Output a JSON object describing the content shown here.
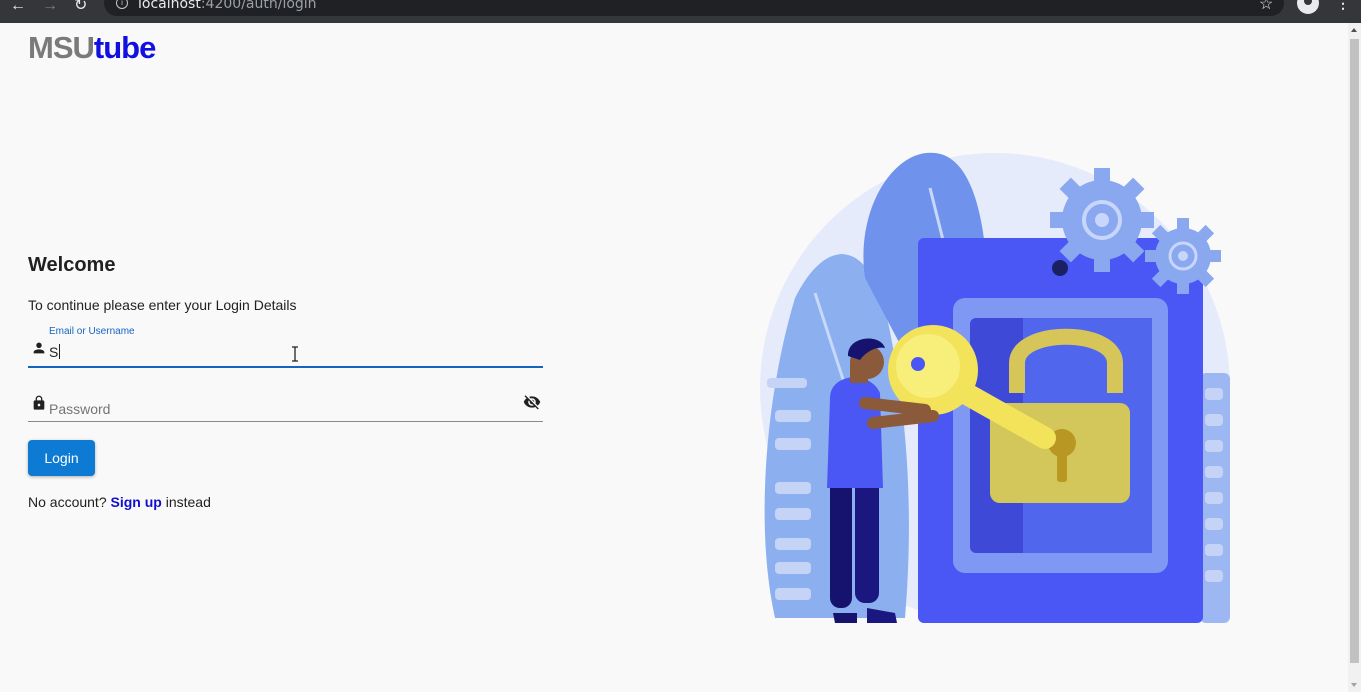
{
  "browser": {
    "url_host": "localhost",
    "url_rest": ":4200/auth/login"
  },
  "logo": {
    "part1": "MSU",
    "part2": "tube"
  },
  "login": {
    "title": "Welcome",
    "subtitle": "To continue please enter your Login Details",
    "email_label": "Email or Username",
    "email_value": "S",
    "password_placeholder": "Password",
    "button_label": "Login",
    "signup_prefix": "No account?",
    "signup_link": "Sign up",
    "signup_suffix": "instead"
  },
  "colors": {
    "accent": "#0d7bd4",
    "logo_gray": "#7a7a7a",
    "logo_blue": "#1010e0",
    "illustration_blue": "#4b57f5",
    "illustration_yellow": "#f2e35b"
  },
  "icons": {
    "email_field": "person-icon",
    "password_field": "lock-icon",
    "password_toggle": "eye-off-icon"
  }
}
